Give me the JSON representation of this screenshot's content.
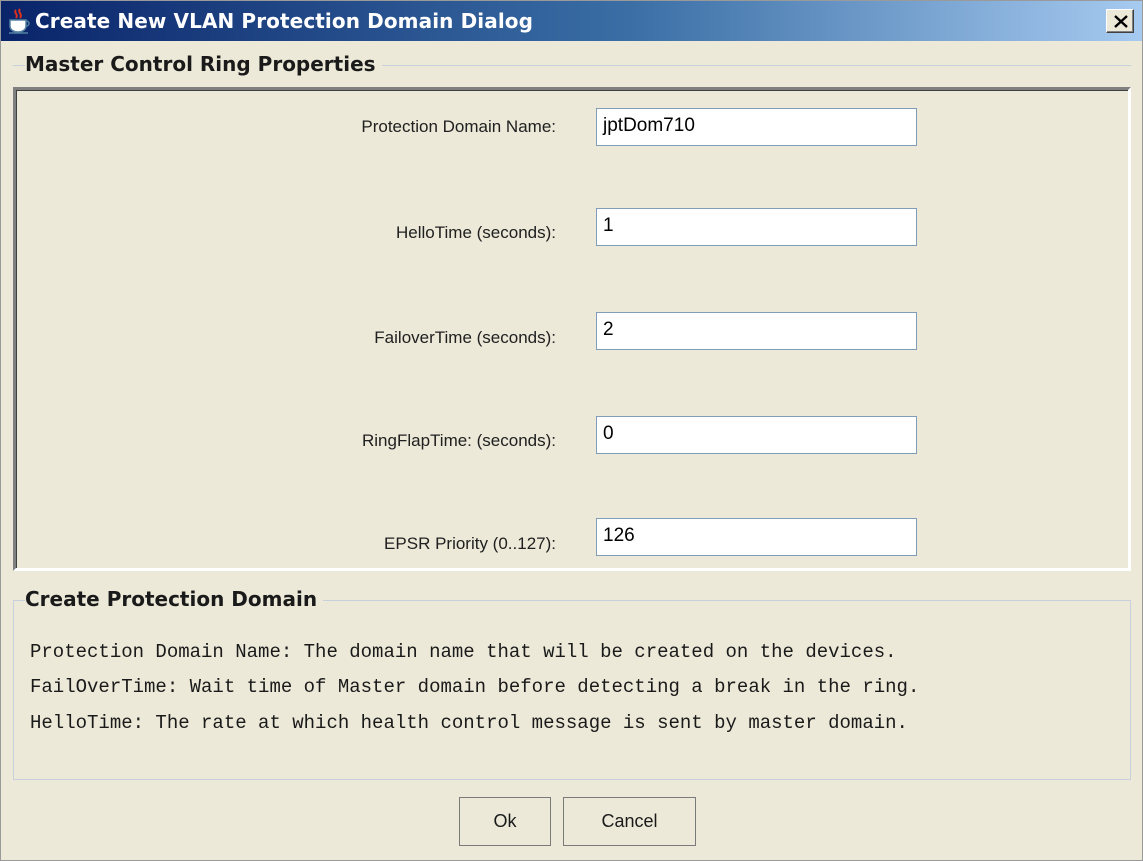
{
  "window": {
    "title": "Create New VLAN Protection Domain Dialog",
    "icons": {
      "app": "java-cup-icon",
      "close": "close-icon"
    }
  },
  "master_group": {
    "title": "Master Control Ring Properties",
    "fields": [
      {
        "label": "Protection Domain Name:",
        "value": "jptDom710"
      },
      {
        "label": "HelloTime (seconds):",
        "value": "1"
      },
      {
        "label": "FailoverTime (seconds):",
        "value": "2"
      },
      {
        "label": "RingFlapTime: (seconds):",
        "value": "0"
      },
      {
        "label": "EPSR Priority (0..127):",
        "value": "126"
      }
    ]
  },
  "create_group": {
    "title": "Create Protection Domain",
    "lines": [
      "Protection Domain Name: The domain name that will be created on the devices.",
      "FailOverTime: Wait time of Master domain before detecting a break in the ring.",
      "HelloTime: The rate at which health control message is sent by master domain."
    ]
  },
  "buttons": {
    "ok": "Ok",
    "cancel": "Cancel"
  },
  "colors": {
    "title_bar_start": "#0A246A",
    "title_bar_end": "#A6CAF0",
    "dialog_background": "#ECE9D8",
    "input_border": "#7F9DB9"
  }
}
